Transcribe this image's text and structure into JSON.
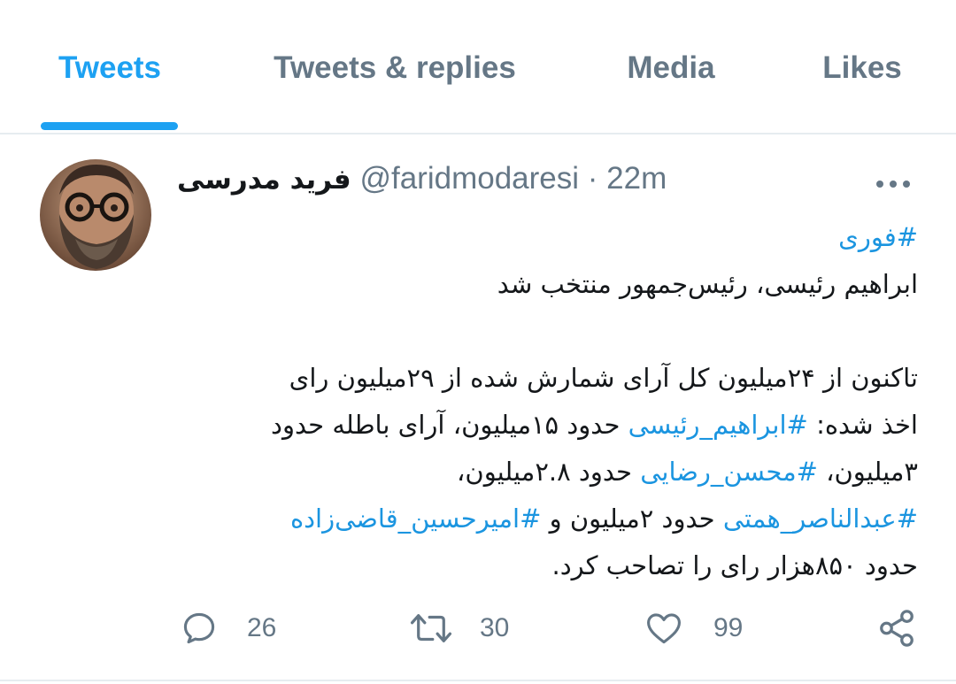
{
  "tabs": [
    {
      "label": "Tweets",
      "active": true
    },
    {
      "label": "Tweets & replies",
      "active": false
    },
    {
      "label": "Media",
      "active": false
    },
    {
      "label": "Likes",
      "active": false
    }
  ],
  "tweet": {
    "author_name": "فرید مدرسی",
    "handle": "@faridmodaresi",
    "separator": "·",
    "time": "22m",
    "more_icon": "more-horizontal-icon",
    "hashtag_top": "#فوری",
    "line1": "ابراهیم رئیسی، رئیس‌جمهور منتخب شد",
    "line2": "تاکنون از ۲۴میلیون کل آرای شمارش شده از ۲۹میلیون رای",
    "line3_a": "اخذ شده: ",
    "line3_tag": "#ابراهیم_رئیسی",
    "line3_b": " حدود ۱۵میلیون، آرای باطله حدود",
    "line4_a": "۳میلیون، ",
    "line4_tag": "#محسن_رضایی",
    "line4_b": " حدود ۲.۸میلیون،",
    "line5_tag1": "#عبدالناصر_همتی",
    "line5_mid": " حدود ۲میلیون و ",
    "line5_tag2": "#امیرحسین_قاضی‌زاده",
    "line6": "حدود ۸۵۰هزار رای را تصاحب کرد.",
    "replies": "26",
    "retweets": "30",
    "likes": "99"
  },
  "colors": {
    "accent": "#1da1f2",
    "link": "#1b95e0",
    "muted": "#657786",
    "divider": "#e6ecf0"
  }
}
